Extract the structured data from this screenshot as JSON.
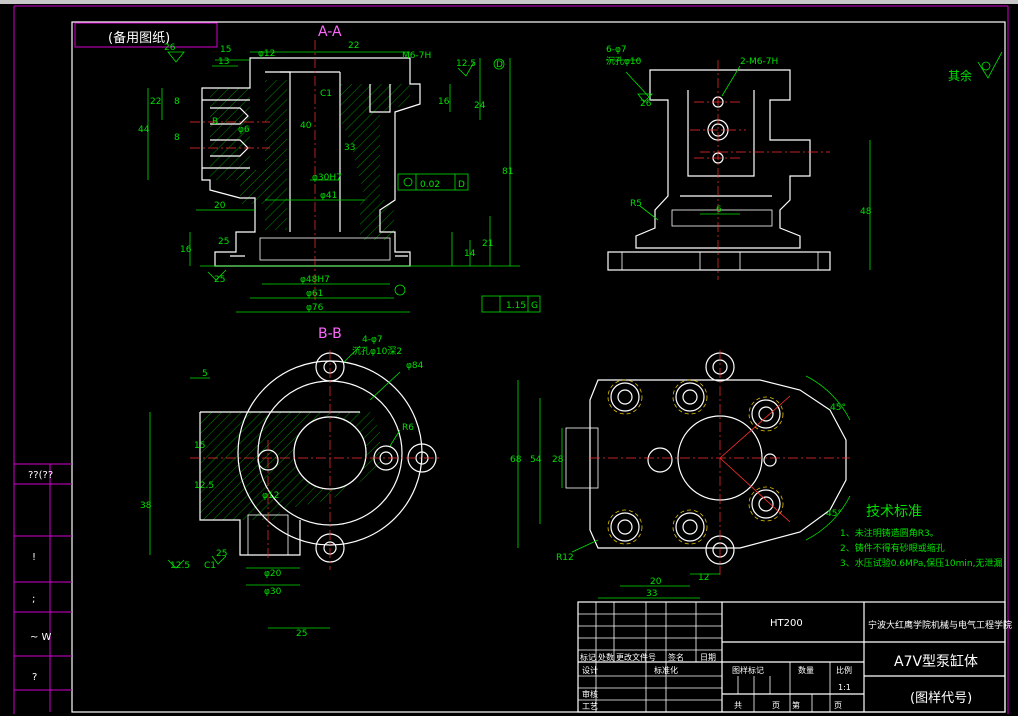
{
  "drawing": {
    "corner_label": "(备用图纸)",
    "roughness_rest": "其余",
    "views": {
      "section_aa": "A-A",
      "section_bb": "B-B"
    },
    "left_panel_labels": [
      "??(??",
      "!",
      ";",
      "~ W",
      "?"
    ],
    "dims_aa": {
      "d26": "26",
      "d15": "15",
      "d13": "13",
      "d12": "φ12",
      "d22": "22",
      "thread": "M6-7H",
      "ra": "12.5",
      "d22v": "22",
      "d44": "44",
      "d8a": "8",
      "d8b": "8",
      "dB": "B",
      "d6": "φ6",
      "d40": "40",
      "d33": "33",
      "c1": "C1",
      "d16a": "16",
      "d24": "24",
      "d81": "81",
      "d30h7": "φ30H7",
      "d41": "φ41",
      "tol": "0.02",
      "datum_d": "D",
      "d20": "20",
      "d25a": "25",
      "d25b": "25",
      "d16b": "16",
      "d14": "14",
      "d21": "21",
      "d48h7": "φ48H7",
      "d61": "φ61",
      "d76": "φ76",
      "par": "1.15",
      "datum_g": "G"
    },
    "dims_top": {
      "holes": "6-φ7",
      "cbore": "沉孔φ10",
      "d26": "26",
      "thread": "2-M6-7H",
      "r5": "R5",
      "d6": "6",
      "d48": "48"
    },
    "dims_bb": {
      "holes": "4-φ7",
      "cbore": "沉孔φ10深2",
      "d84": "φ84",
      "d5": "5",
      "r6": "R6",
      "d15": "15",
      "d12_5": "12.5",
      "d38": "38",
      "d12": "φ12",
      "d25a": "25",
      "c1": "C1",
      "ra": "12.5",
      "d20": "φ20",
      "d30": "φ30",
      "d25b": "25"
    },
    "dims_front": {
      "d68": "68",
      "d54": "54",
      "d28": "28",
      "r12": "R12",
      "d20": "20",
      "d33": "33",
      "d12": "12",
      "a45a": "45°",
      "a45b": "45°"
    },
    "tech": {
      "title": "技术标准",
      "items": [
        "1、未注明铸造圆角R3。",
        "2、铸件不得有砂眼或缩孔",
        "3、水压试验0.6MPa,保压10min,无泄漏"
      ]
    },
    "title_block": {
      "material": "HT200",
      "school": "宁波大红鹰学院机械与电气工程学院",
      "part_name": "A7V型泵缸体",
      "drawing_code": "(图样代号)",
      "row_headers": [
        "标记",
        "处数",
        "更改文件号",
        "签名",
        "日期"
      ],
      "designer": "设计",
      "standardize": "标准化",
      "check": "审核",
      "process": "工艺",
      "stage_mark": "图样标记",
      "quantity": "数量",
      "scale_label": "比例",
      "scale": "1:1",
      "sheet_total": "共",
      "sheet_unit": "页",
      "sheet_no": "第",
      "sheet_unit2": "页"
    }
  }
}
